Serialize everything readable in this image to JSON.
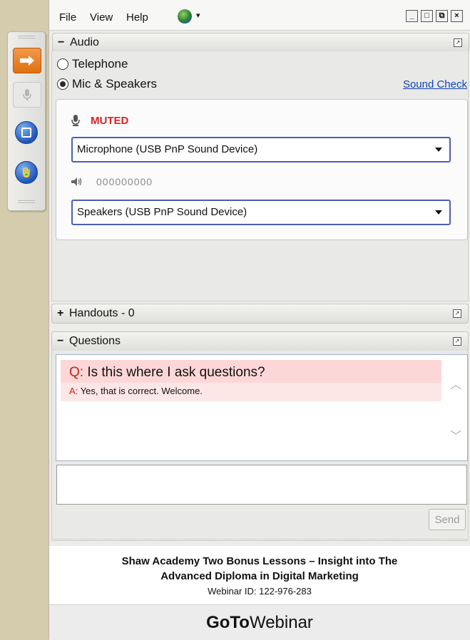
{
  "menu": [
    "File",
    "View",
    "Help"
  ],
  "audio": {
    "title": "Audio",
    "toggle": "−",
    "options": [
      {
        "label": "Telephone",
        "selected": false
      },
      {
        "label": "Mic & Speakers",
        "selected": true
      }
    ],
    "sound_check": "Sound Check",
    "mic_status": "MUTED",
    "microphone": "Microphone (USB PnP Sound Device)",
    "level": "000000000",
    "speakers": "Speakers (USB PnP Sound Device)"
  },
  "handouts": {
    "title": "Handouts - 0",
    "toggle": "+"
  },
  "questions": {
    "title": "Questions",
    "toggle": "−",
    "q_tag": "Q:",
    "question": "Is this where I ask questions?",
    "a_tag": "A:",
    "answer": "Yes, that is correct. Welcome.",
    "send": "Send"
  },
  "webinar": {
    "title_line1": "Shaw Academy Two Bonus Lessons – Insight into The",
    "title_line2": "Advanced Diploma in Digital Marketing",
    "id_label": "Webinar ID: 122-976-283"
  },
  "brand": {
    "bold": "GoTo",
    "rest": "Webinar"
  },
  "colors": {
    "muted": "#e02020",
    "link": "#1045b0",
    "accent_orange": "#e97b20",
    "accent_blue": "#2a62c4"
  }
}
